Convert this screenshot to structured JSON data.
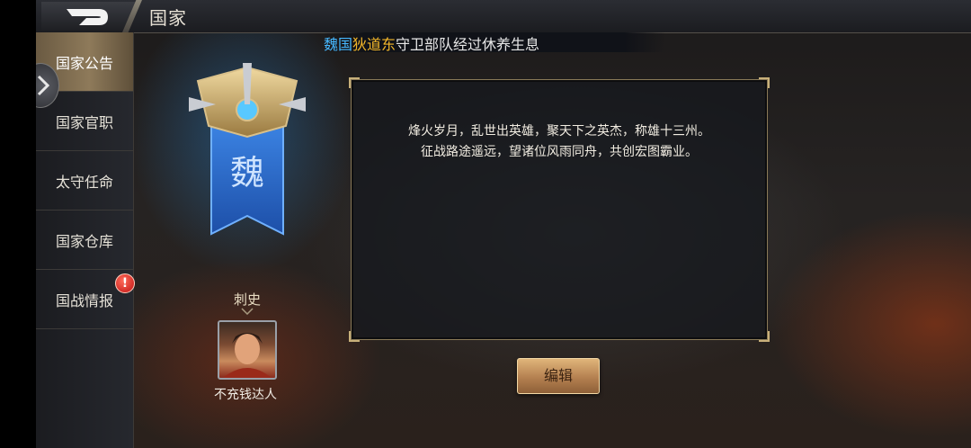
{
  "header": {
    "title": "国家"
  },
  "marquee": {
    "country": "魏国",
    "location": "狄道东",
    "text": "守卫部队经过休养生息"
  },
  "sidebar": {
    "items": [
      {
        "label": "国家公告",
        "active": true
      },
      {
        "label": "国家官职",
        "active": false
      },
      {
        "label": "太守任命",
        "active": false
      },
      {
        "label": "国家仓库",
        "active": false
      },
      {
        "label": "国战情报",
        "active": false,
        "badge": "!"
      }
    ]
  },
  "emblem": {
    "character": "魏",
    "icon": "wei-banner-icon"
  },
  "official": {
    "rank": "刺史",
    "name": "不充钱达人"
  },
  "notice": {
    "lines": [
      "烽火岁月，乱世出英雄，聚天下之英杰，称雄十三州。",
      "征战路途遥远，望诸位风雨同舟，共创宏图霸业。"
    ]
  },
  "buttons": {
    "edit": "编辑"
  },
  "colors": {
    "accent_gold": "#c8b07a",
    "wei_blue": "#2f6fd6",
    "alert_red": "#c01313"
  }
}
